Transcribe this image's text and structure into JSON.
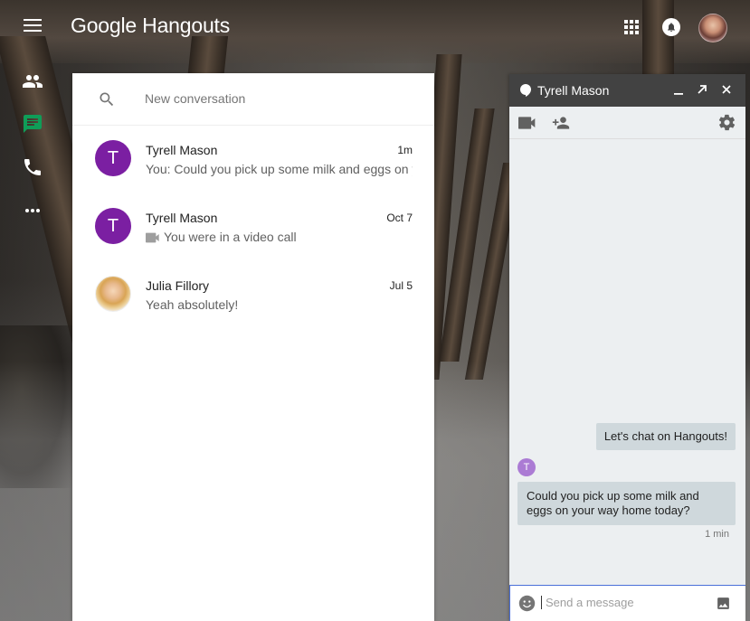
{
  "app": {
    "brand_google": "Google",
    "brand_product": "Hangouts"
  },
  "icons": {
    "menu": "menu-icon",
    "apps": "apps-grid-icon",
    "notifications": "bell-icon",
    "contacts": "people-icon",
    "messages": "message-icon",
    "phone": "phone-icon",
    "more": "more-horiz-icon"
  },
  "colors": {
    "accent_green": "#0f9d58",
    "avatar_purple": "#7b1fa2",
    "chat_header": "#424242",
    "bubble": "#cfd8dc"
  },
  "search": {
    "placeholder": "New conversation"
  },
  "conversations": [
    {
      "initial": "T",
      "name": "Tyrell Mason",
      "time": "1m",
      "snippet": "You: Could you pick up some milk and eggs on your way home today?"
    },
    {
      "initial": "T",
      "name": "Tyrell Mason",
      "time": "Oct 7",
      "snippet": "You were in a video call"
    },
    {
      "initial": "",
      "name": "Julia Fillory",
      "time": "Jul 5",
      "snippet": "Yeah absolutely!"
    }
  ],
  "chat": {
    "title": "Tyrell Mason",
    "messages": [
      {
        "from": "me",
        "text": "Let's chat on Hangouts!"
      },
      {
        "from": "T",
        "text": "Could you pick up some milk and eggs on your way home today?"
      }
    ],
    "last_time": "1 min",
    "composer_placeholder": "Send a message"
  }
}
